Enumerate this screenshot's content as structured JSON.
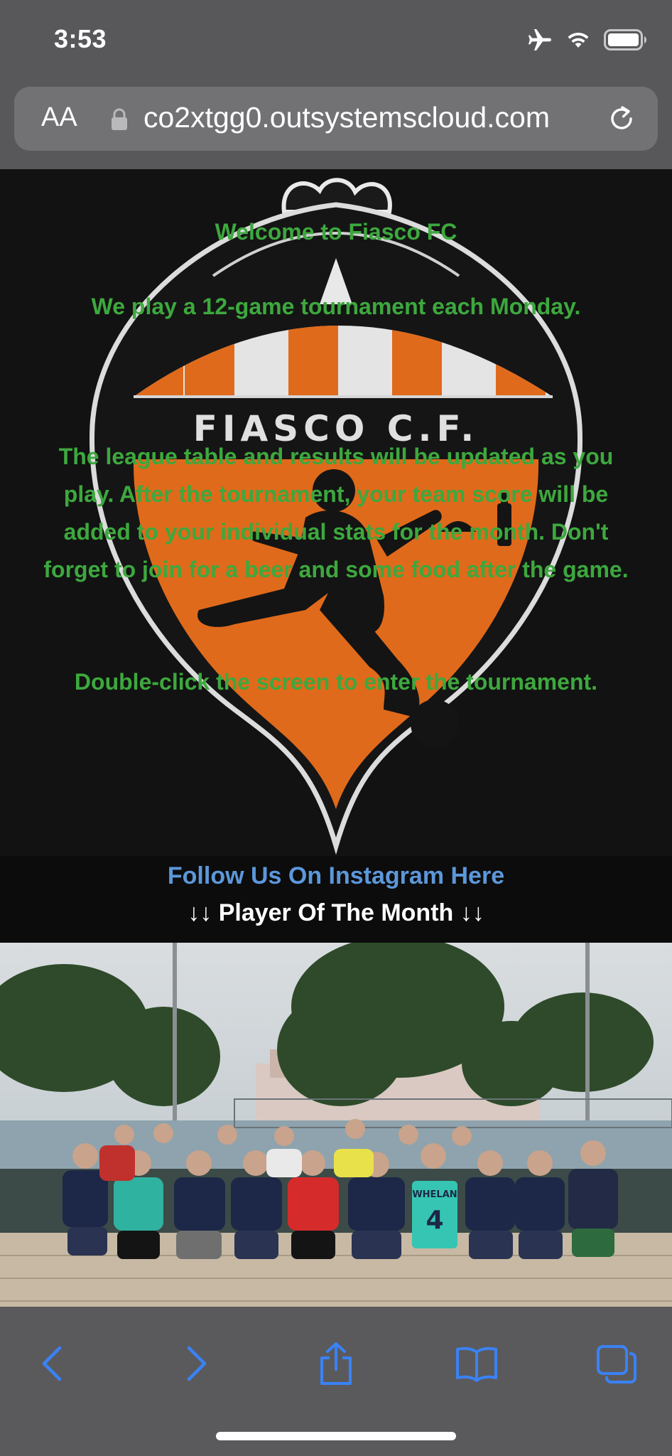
{
  "status_bar": {
    "time": "3:53"
  },
  "browser": {
    "aa_label": "AA",
    "url": "co2xtgg0.outsystemscloud.com"
  },
  "hero": {
    "crest_text": "FIASCO C.F.",
    "paragraphs": [
      "Welcome to Fiasco FC",
      "We play a 12-game tournament each Monday.",
      "The league table and results will be updated as you play. After the tournament, your team score will be added to your individual stats for the month. Don't forget to join for a beer and some food after the game.",
      "Double-click the screen to enter the tournament."
    ]
  },
  "links": {
    "instagram": "Follow Us On Instagram Here",
    "player_of_month": "↓↓ Player Of The Month ↓↓"
  },
  "photo": {
    "jersey_name": "WHELAN",
    "jersey_number": "4"
  },
  "toolbar": {
    "back_icon": "chevron-left-icon",
    "forward_icon": "chevron-right-icon",
    "share_icon": "share-icon",
    "bookmarks_icon": "book-icon",
    "tabs_icon": "tabs-icon"
  },
  "colors": {
    "accent_blue": "#3a82f6",
    "hero_text_green": "#3da83e",
    "crest_orange": "#e06a1b",
    "link_blue": "#5c97da"
  }
}
